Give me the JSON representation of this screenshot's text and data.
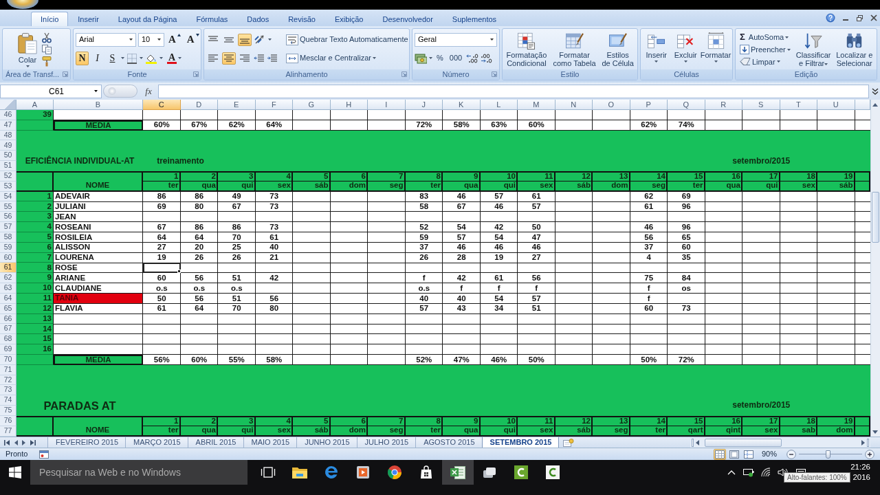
{
  "ribbon": {
    "tabs": [
      {
        "label": "Início",
        "selected": true
      },
      {
        "label": "Inserir",
        "selected": false
      },
      {
        "label": "Layout da Página",
        "selected": false
      },
      {
        "label": "Fórmulas",
        "selected": false
      },
      {
        "label": "Dados",
        "selected": false
      },
      {
        "label": "Revisão",
        "selected": false
      },
      {
        "label": "Exibição",
        "selected": false
      },
      {
        "label": "Desenvolvedor",
        "selected": false
      },
      {
        "label": "Suplementos",
        "selected": false
      }
    ],
    "clipboard": {
      "title": "Área de Transf...",
      "paste": "Colar"
    },
    "font": {
      "title": "Fonte",
      "family": "Arial",
      "size": "10",
      "grow": "A",
      "shrink": "A",
      "styles": [
        {
          "kind": "bold",
          "label": "N",
          "selected": true
        },
        {
          "kind": "italic",
          "label": "I",
          "selected": false
        },
        {
          "kind": "underline",
          "label": "S",
          "selected": false
        }
      ],
      "color_letter": "A"
    },
    "alignment": {
      "title": "Alinhamento",
      "vertical": [
        {
          "kind": "top",
          "selected": false
        },
        {
          "kind": "middle",
          "selected": false
        },
        {
          "kind": "bottom",
          "selected": true
        }
      ],
      "horizontal": [
        {
          "kind": "left",
          "selected": false
        },
        {
          "kind": "center",
          "selected": true
        },
        {
          "kind": "right",
          "selected": false
        }
      ],
      "wrap": "Quebrar Texto Automaticamente",
      "merge": "Mesclar e Centralizar"
    },
    "number": {
      "title": "Número",
      "format": "Geral",
      "percent": "%",
      "thousands": "000"
    },
    "styles": {
      "title": "Estilo",
      "buttons": [
        {
          "kind": "conditional",
          "label": "Formatação Condicional"
        },
        {
          "kind": "table",
          "label": "Formatar como Tabela"
        },
        {
          "kind": "cell",
          "label": "Estilos de Célula"
        }
      ]
    },
    "cells": {
      "title": "Células",
      "buttons": [
        {
          "kind": "insert",
          "label": "Inserir"
        },
        {
          "kind": "delete",
          "label": "Excluir"
        },
        {
          "kind": "format",
          "label": "Formatar"
        }
      ]
    },
    "editing": {
      "title": "Edição",
      "small": [
        {
          "kind": "autosum",
          "glyph": "Σ",
          "label": "AutoSoma"
        },
        {
          "kind": "fill",
          "label": "Preencher"
        },
        {
          "kind": "clear",
          "label": "Limpar"
        }
      ],
      "large": [
        {
          "kind": "sort",
          "label": "Classificar e Filtrar"
        },
        {
          "kind": "find",
          "label": "Localizar e Selecionar"
        }
      ]
    }
  },
  "formula_bar": {
    "name_box": "C61",
    "function_button": "fx"
  },
  "sheet": {
    "columns": [
      {
        "label": "A",
        "selected": false
      },
      {
        "label": "B",
        "selected": false
      },
      {
        "label": "C",
        "selected": true
      },
      {
        "label": "D",
        "selected": false
      },
      {
        "label": "E",
        "selected": false
      },
      {
        "label": "F",
        "selected": false
      },
      {
        "label": "G",
        "selected": false
      },
      {
        "label": "H",
        "selected": false
      },
      {
        "label": "I",
        "selected": false
      },
      {
        "label": "J",
        "selected": false
      },
      {
        "label": "K",
        "selected": false
      },
      {
        "label": "L",
        "selected": false
      },
      {
        "label": "M",
        "selected": false
      },
      {
        "label": "N",
        "selected": false
      },
      {
        "label": "O",
        "selected": false
      },
      {
        "label": "P",
        "selected": false
      },
      {
        "label": "Q",
        "selected": false
      },
      {
        "label": "R",
        "selected": false
      },
      {
        "label": "S",
        "selected": false
      },
      {
        "label": "T",
        "selected": false
      },
      {
        "label": "U",
        "selected": false
      }
    ],
    "rows": [
      {
        "number": "46",
        "selected": false,
        "kind": "data",
        "index": "39"
      },
      {
        "number": "47",
        "selected": false,
        "kind": "average",
        "label": "MEDIA",
        "values": {
          "C": "60%",
          "D": "67%",
          "E": "62%",
          "F": "64%",
          "J": "72%",
          "K": "58%",
          "L": "63%",
          "M": "60%",
          "P": "62%",
          "Q": "74%"
        }
      },
      {
        "number": "48",
        "selected": false,
        "kind": "band"
      },
      {
        "number": "49",
        "selected": false,
        "kind": "band"
      },
      {
        "number": "50",
        "selected": false,
        "kind": "band"
      },
      {
        "number": "51",
        "selected": false,
        "kind": "title",
        "title": "EFICIÊNCIA INDIVIDUAL-AT",
        "subtitle": "treinamento",
        "date": "setembro/2015"
      },
      {
        "number": "52",
        "selected": false,
        "kind": "day_numbers",
        "values": [
          "1",
          "2",
          "3",
          "4",
          "5",
          "6",
          "7",
          "8",
          "9",
          "10",
          "11",
          "12",
          "13",
          "14",
          "15",
          "16",
          "17",
          "18",
          "19"
        ]
      },
      {
        "number": "53",
        "selected": false,
        "kind": "weekdays",
        "label": "NOME",
        "values": [
          "ter",
          "qua",
          "qui",
          "sex",
          "sáb",
          "dom",
          "seg",
          "ter",
          "qua",
          "qui",
          "sex",
          "sáb",
          "dom",
          "seg",
          "ter",
          "qua",
          "qui",
          "sex",
          "sáb"
        ]
      },
      {
        "number": "54",
        "selected": false,
        "kind": "data",
        "index": "1",
        "name": "ADEVAIR",
        "highlighted": false,
        "values": {
          "C": "86",
          "D": "86",
          "E": "49",
          "F": "73",
          "J": "83",
          "K": "46",
          "L": "57",
          "M": "61",
          "P": "62",
          "Q": "69"
        }
      },
      {
        "number": "55",
        "selected": false,
        "kind": "data",
        "index": "2",
        "name": "JULIANI",
        "highlighted": false,
        "values": {
          "C": "69",
          "D": "80",
          "E": "67",
          "F": "73",
          "J": "58",
          "K": "67",
          "L": "46",
          "M": "57",
          "P": "61",
          "Q": "96"
        }
      },
      {
        "number": "56",
        "selected": false,
        "kind": "data",
        "index": "3",
        "name": "JEAN",
        "highlighted": false
      },
      {
        "number": "57",
        "selected": false,
        "kind": "data",
        "index": "4",
        "name": "ROSEANI",
        "highlighted": false,
        "values": {
          "C": "67",
          "D": "86",
          "E": "86",
          "F": "73",
          "J": "52",
          "K": "54",
          "L": "42",
          "M": "50",
          "P": "46",
          "Q": "96"
        }
      },
      {
        "number": "58",
        "selected": false,
        "kind": "data",
        "index": "5",
        "name": "ROSILEIA",
        "highlighted": false,
        "values": {
          "C": "64",
          "D": "64",
          "E": "70",
          "F": "61",
          "J": "59",
          "K": "57",
          "L": "54",
          "M": "47",
          "P": "56",
          "Q": "65"
        }
      },
      {
        "number": "59",
        "selected": false,
        "kind": "data",
        "index": "6",
        "name": "ALISSON",
        "highlighted": false,
        "values": {
          "C": "27",
          "D": "20",
          "E": "25",
          "F": "40",
          "J": "37",
          "K": "46",
          "L": "46",
          "M": "46",
          "P": "37",
          "Q": "60"
        }
      },
      {
        "number": "60",
        "selected": false,
        "kind": "data",
        "index": "7",
        "name": "LOURENA",
        "highlighted": false,
        "values": {
          "C": "19",
          "D": "26",
          "E": "26",
          "F": "21",
          "J": "26",
          "K": "28",
          "L": "19",
          "M": "27",
          "P": "4",
          "Q": "35"
        }
      },
      {
        "number": "61",
        "selected": true,
        "kind": "data",
        "index": "8",
        "name": "ROSE",
        "highlighted": false
      },
      {
        "number": "62",
        "selected": false,
        "kind": "data",
        "index": "9",
        "name": "ARIANE",
        "highlighted": false,
        "values": {
          "C": "60",
          "D": "56",
          "E": "51",
          "F": "42",
          "J": "f",
          "K": "42",
          "L": "61",
          "M": "56",
          "P": "75",
          "Q": "84"
        }
      },
      {
        "number": "63",
        "selected": false,
        "kind": "data",
        "index": "10",
        "name": "CLAUDIANE",
        "highlighted": false,
        "values": {
          "C": "o.s",
          "D": "o.s",
          "E": "o.s",
          "J": "o.s",
          "K": "f",
          "L": "f",
          "M": "f",
          "P": "f",
          "Q": "os"
        }
      },
      {
        "number": "64",
        "selected": false,
        "kind": "data",
        "index": "11",
        "name": "TANIA",
        "highlighted": true,
        "values": {
          "C": "50",
          "D": "56",
          "E": "51",
          "F": "56",
          "J": "40",
          "K": "40",
          "L": "54",
          "M": "57",
          "P": "f"
        }
      },
      {
        "number": "65",
        "selected": false,
        "kind": "data",
        "index": "12",
        "name": "FLAVIA",
        "highlighted": false,
        "values": {
          "C": "61",
          "D": "64",
          "E": "70",
          "F": "80",
          "J": "57",
          "K": "43",
          "L": "34",
          "M": "51",
          "P": "60",
          "Q": "73"
        }
      },
      {
        "number": "66",
        "selected": false,
        "kind": "data",
        "index": "13"
      },
      {
        "number": "67",
        "selected": false,
        "kind": "data",
        "index": "14"
      },
      {
        "number": "68",
        "selected": false,
        "kind": "data",
        "index": "15"
      },
      {
        "number": "69",
        "selected": false,
        "kind": "data",
        "index": "16"
      },
      {
        "number": "70",
        "selected": false,
        "kind": "average",
        "label": "MEDIA",
        "values": {
          "C": "56%",
          "D": "60%",
          "E": "55%",
          "F": "58%",
          "J": "52%",
          "K": "47%",
          "L": "46%",
          "M": "50%",
          "P": "50%",
          "Q": "72%"
        }
      },
      {
        "number": "71",
        "selected": false,
        "kind": "band"
      },
      {
        "number": "72",
        "selected": false,
        "kind": "band"
      },
      {
        "number": "73",
        "selected": false,
        "kind": "band"
      },
      {
        "number": "74",
        "selected": false,
        "kind": "band"
      },
      {
        "number": "75",
        "selected": false,
        "kind": "heading",
        "title": "PARADAS AT",
        "date": "setembro/2015"
      },
      {
        "number": "76",
        "selected": false,
        "kind": "day_numbers",
        "values": [
          "1",
          "2",
          "3",
          "4",
          "5",
          "6",
          "7",
          "8",
          "9",
          "10",
          "11",
          "12",
          "13",
          "14",
          "15",
          "16",
          "17",
          "18",
          "19"
        ]
      },
      {
        "number": "77",
        "selected": false,
        "kind": "weekdays",
        "label": "NOME",
        "values": [
          "ter",
          "qua",
          "qui",
          "sex",
          "sáb",
          "dom",
          "seg",
          "ter",
          "qua",
          "qui",
          "sex",
          "sáb",
          "seg",
          "ter",
          "qart",
          "qint",
          "sex",
          "sab",
          "dom"
        ]
      }
    ]
  },
  "sheet_tabs": [
    {
      "label": "FEVEREIRO 2015",
      "selected": false
    },
    {
      "label": "MARÇO 2015",
      "selected": false
    },
    {
      "label": "ABRIL 2015",
      "selected": false
    },
    {
      "label": "MAIO 2015",
      "selected": false
    },
    {
      "label": "JUNHO 2015",
      "selected": false
    },
    {
      "label": "JULHO 2015",
      "selected": false
    },
    {
      "label": "AGOSTO 2015",
      "selected": false
    },
    {
      "label": "SETEMBRO 2015",
      "selected": true
    }
  ],
  "status_bar": {
    "status": "Pronto",
    "views": [
      {
        "kind": "normal",
        "selected": true
      },
      {
        "kind": "page_layout",
        "selected": false
      },
      {
        "kind": "page_break",
        "selected": false
      }
    ],
    "zoom": "90%",
    "zoom_slider": {
      "level": 0.46
    }
  },
  "taskbar": {
    "search": {
      "placeholder": "Pesquisar na Web e no Windows"
    },
    "apps": [
      {
        "kind": "task_view",
        "selected": false
      },
      {
        "kind": "folder",
        "selected": false
      },
      {
        "kind": "browser_e",
        "selected": false
      },
      {
        "kind": "player",
        "selected": false
      },
      {
        "kind": "browser_round",
        "selected": false
      },
      {
        "kind": "store",
        "selected": false
      },
      {
        "kind": "spreadsheet",
        "selected": true
      },
      {
        "kind": "stack",
        "selected": false
      },
      {
        "kind": "recorder",
        "selected": false
      },
      {
        "kind": "recorder_light",
        "selected": false
      }
    ],
    "time": "21:26",
    "date": "2016",
    "tooltip": "Alto-falantes: 100%"
  }
}
